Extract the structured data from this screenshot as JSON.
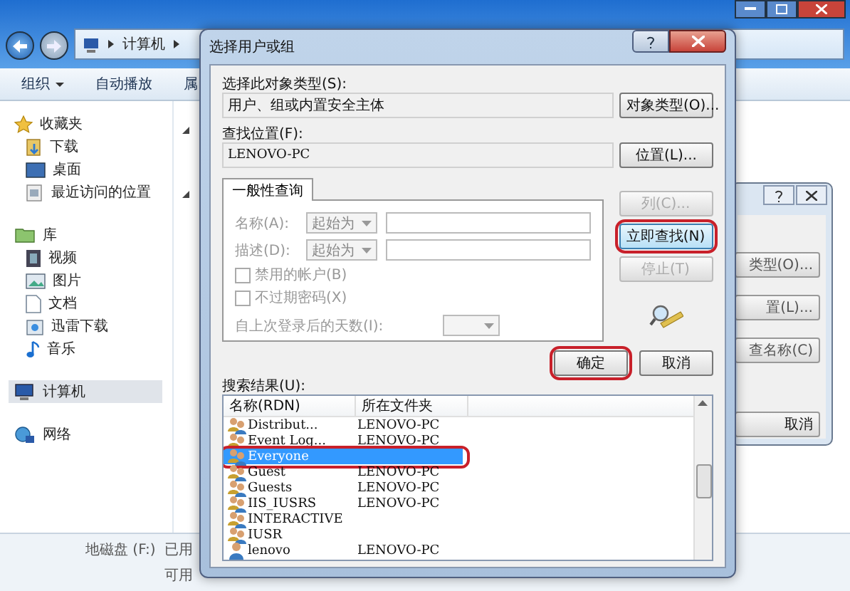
{
  "explorer": {
    "address": [
      "计算机"
    ],
    "toolbar": [
      {
        "label": "组织",
        "dropdown": true
      },
      {
        "label": "自动播放",
        "dropdown": false
      },
      {
        "label": "属",
        "dropdown": false
      }
    ],
    "sidebar": [
      {
        "label": "收藏夹",
        "selected": false,
        "children": [
          {
            "label": "下载",
            "selected": false
          },
          {
            "label": "桌面",
            "selected": false
          },
          {
            "label": "最近访问的位置",
            "selected": false
          }
        ]
      },
      {
        "label": "库",
        "selected": false,
        "children": [
          {
            "label": "视频",
            "selected": false
          },
          {
            "label": "图片",
            "selected": false
          },
          {
            "label": "文档",
            "selected": false
          },
          {
            "label": "迅雷下载",
            "selected": false
          },
          {
            "label": "音乐",
            "selected": false
          }
        ]
      },
      {
        "label": "计算机",
        "selected": true
      },
      {
        "label": "网络",
        "selected": false
      }
    ],
    "drive": {
      "name": "地磁盘 (F:)",
      "used": "已用",
      "free": "可用"
    }
  },
  "back_dialog": {
    "buttons": [
      "类型(O)...",
      "置(L)...",
      "查名称(C)",
      "取消"
    ]
  },
  "dialog": {
    "title": "选择用户或组",
    "object_type": {
      "label": "选择此对象类型(S):",
      "value": "用户、组或内置安全主体",
      "button": "对象类型(O)..."
    },
    "location": {
      "label": "查找位置(F):",
      "value": "LENOVO-PC",
      "button": "位置(L)..."
    },
    "tab": "一般性查询",
    "query_rows": [
      {
        "label": "名称(A):",
        "mode": "起始为",
        "disabled": true
      },
      {
        "label": "描述(D):",
        "mode": "起始为",
        "disabled": true
      }
    ],
    "checkboxes": [
      {
        "label": "禁用的帐户(B)",
        "checked": false,
        "disabled": true
      },
      {
        "label": "不过期密码(X)",
        "checked": false,
        "disabled": true
      }
    ],
    "days": {
      "label": "自上次登录后的天数(I):",
      "disabled": true
    },
    "side_buttons": [
      {
        "label": "列(C)...",
        "disabled": true,
        "highlighted": false
      },
      {
        "label": "立即查找(N)",
        "disabled": false,
        "highlighted": true
      },
      {
        "label": "停止(T)",
        "disabled": true,
        "highlighted": false
      }
    ],
    "ok": {
      "label": "确定",
      "highlighted": true
    },
    "cancel": "取消",
    "results": {
      "label": "搜索结果(U):",
      "columns": [
        "名称(RDN)",
        "所在文件夹"
      ],
      "rows": [
        {
          "name": "Distribut...",
          "folder": "LENOVO-PC",
          "kind": "group",
          "selected": false,
          "highlighted": false
        },
        {
          "name": "Event Log...",
          "folder": "LENOVO-PC",
          "kind": "group",
          "selected": false,
          "highlighted": false
        },
        {
          "name": "Everyone",
          "folder": "",
          "kind": "group",
          "selected": true,
          "highlighted": true
        },
        {
          "name": "Guest",
          "folder": "LENOVO-PC",
          "kind": "group",
          "selected": false,
          "highlighted": false
        },
        {
          "name": "Guests",
          "folder": "LENOVO-PC",
          "kind": "group",
          "selected": false,
          "highlighted": false
        },
        {
          "name": "IIS_IUSRS",
          "folder": "LENOVO-PC",
          "kind": "group",
          "selected": false,
          "highlighted": false
        },
        {
          "name": "INTERACTIVE",
          "folder": "",
          "kind": "group",
          "selected": false,
          "highlighted": false
        },
        {
          "name": "IUSR",
          "folder": "",
          "kind": "group",
          "selected": false,
          "highlighted": false
        },
        {
          "name": "lenovo",
          "folder": "LENOVO-PC",
          "kind": "user",
          "selected": false,
          "highlighted": false
        }
      ]
    }
  }
}
